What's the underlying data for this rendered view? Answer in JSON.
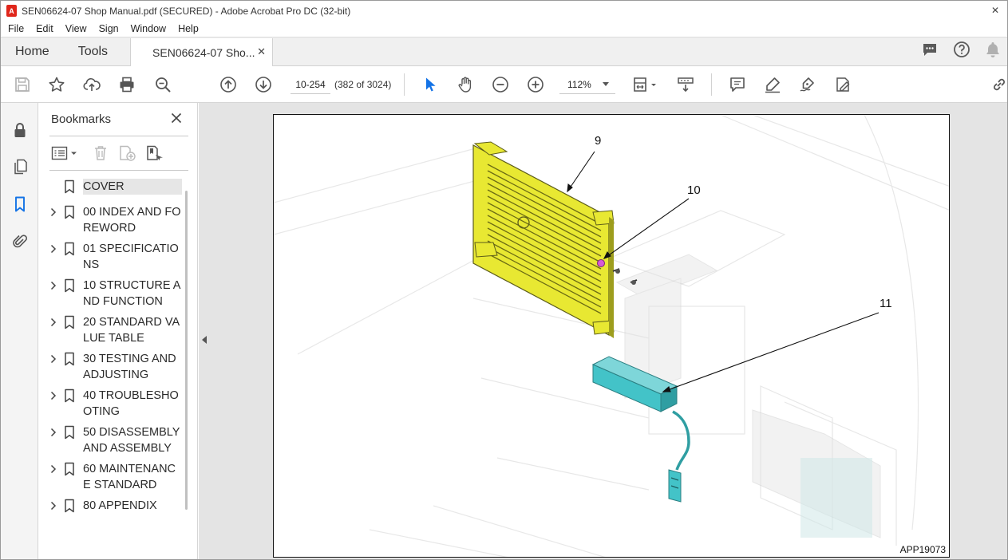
{
  "window": {
    "title": "SEN06624-07 Shop Manual.pdf (SECURED) - Adobe Acrobat Pro DC (32-bit)"
  },
  "menu": [
    "File",
    "Edit",
    "View",
    "Sign",
    "Window",
    "Help"
  ],
  "tabs": {
    "home": "Home",
    "tools": "Tools",
    "document": "SEN06624-07 Sho..."
  },
  "toolbar": {
    "page_label": "10-254",
    "page_count": "(382 of 3024)",
    "zoom": "112%"
  },
  "bookmarks": {
    "title": "Bookmarks",
    "items": [
      {
        "label": "COVER",
        "has_children": false,
        "selected": true
      },
      {
        "label": " 00 INDEX AND FOREWORD",
        "has_children": true
      },
      {
        "label": " 01 SPECIFICATIONS",
        "has_children": true
      },
      {
        "label": " 10 STRUCTURE AND FUNCTION",
        "has_children": true
      },
      {
        "label": " 20 STANDARD VALUE TABLE",
        "has_children": true
      },
      {
        "label": " 30 TESTING AND ADJUSTING",
        "has_children": true
      },
      {
        "label": " 40 TROUBLESHOOTING",
        "has_children": true
      },
      {
        "label": " 50 DISASSEMBLY AND ASSEMBLY",
        "has_children": true
      },
      {
        "label": " 60 MAINTENANCE STANDARD",
        "has_children": true
      },
      {
        "label": " 80 APPENDIX",
        "has_children": true
      }
    ]
  },
  "figure": {
    "callouts": [
      "9",
      "10",
      "11"
    ],
    "code": "APP19073"
  },
  "colors": {
    "accent_blue": "#1473e6",
    "plate_yellow": "#e8e832",
    "module_teal": "#43c3c8",
    "bolt_pink": "#d65ad6"
  }
}
